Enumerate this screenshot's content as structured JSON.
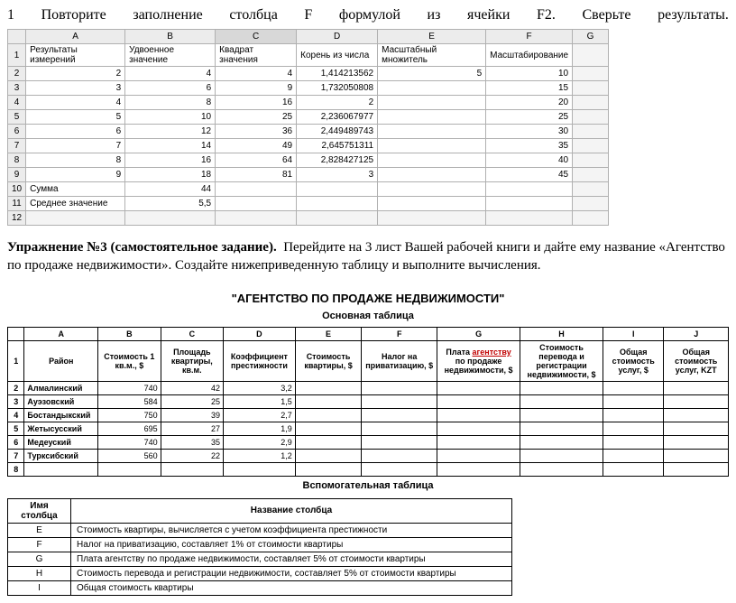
{
  "top_instruction": [
    "1",
    "Повторите",
    "заполнение",
    "столбца",
    "F",
    "формулой",
    "из",
    "ячейки",
    "F2.",
    "Сверьте",
    "результаты."
  ],
  "ss": {
    "cols": [
      "",
      "A",
      "B",
      "C",
      "D",
      "E",
      "F",
      "G"
    ],
    "header_row": [
      "1",
      "Результаты измерений",
      "Удвоенное значение",
      "Квадрат значения",
      "Корень из числа",
      "Масштабный множитель",
      "Масштабирование",
      ""
    ],
    "rows": [
      [
        "2",
        "2",
        "4",
        "4",
        "1,414213562",
        "5",
        "10",
        ""
      ],
      [
        "3",
        "3",
        "6",
        "9",
        "1,732050808",
        "",
        "15",
        ""
      ],
      [
        "4",
        "4",
        "8",
        "16",
        "2",
        "",
        "20",
        ""
      ],
      [
        "5",
        "5",
        "10",
        "25",
        "2,236067977",
        "",
        "25",
        ""
      ],
      [
        "6",
        "6",
        "12",
        "36",
        "2,449489743",
        "",
        "30",
        ""
      ],
      [
        "7",
        "7",
        "14",
        "49",
        "2,645751311",
        "",
        "35",
        ""
      ],
      [
        "8",
        "8",
        "16",
        "64",
        "2,828427125",
        "",
        "40",
        ""
      ],
      [
        "9",
        "9",
        "18",
        "81",
        "3",
        "",
        "45",
        ""
      ],
      [
        "10",
        "Сумма",
        "44",
        "",
        "",
        "",
        "",
        ""
      ],
      [
        "11",
        "Среднее значение",
        "5,5",
        "",
        "",
        "",
        "",
        ""
      ],
      [
        "12",
        "",
        "",
        "",
        "",
        "",
        "",
        ""
      ]
    ]
  },
  "ex3": {
    "title": "Упражнение №3 (самостоятельное задание).",
    "text": "Перейдите на 3 лист Вашей рабочей книги и дайте ему название «Агентство по продаже недвижимости». Создайте нижеприведенную таблицу и выполните вычисления."
  },
  "agency": {
    "title": "\"АГЕНТСТВО ПО ПРОДАЖЕ НЕДВИЖИМОСТИ\"",
    "subtitle": "Основная таблица",
    "col_letters": [
      "",
      "A",
      "B",
      "C",
      "D",
      "E",
      "F",
      "G",
      "H",
      "I",
      "J"
    ],
    "col_names": [
      "1",
      "Район",
      "Стоимость 1 кв.м., $",
      "Площадь квартиры, кв.м.",
      "Коэффициент престижности",
      "Стоимость квартиры, $",
      "Налог на приватизацию, $",
      "Плата агентству по продаже недвижимости, $",
      "Стоимость перевода и регистрации недвижимости, $",
      "Общая стоимость услуг, $",
      "Общая стоимость услуг, KZT"
    ],
    "agency_red": "агентству",
    "rows": [
      [
        "2",
        "Алмалинский",
        "740",
        "42",
        "3,2",
        "",
        "",
        "",
        "",
        "",
        ""
      ],
      [
        "3",
        "Ауэзовский",
        "584",
        "25",
        "1,5",
        "",
        "",
        "",
        "",
        "",
        ""
      ],
      [
        "4",
        "Бостандыкский",
        "750",
        "39",
        "2,7",
        "",
        "",
        "",
        "",
        "",
        ""
      ],
      [
        "5",
        "Жетысусский",
        "695",
        "27",
        "1,9",
        "",
        "",
        "",
        "",
        "",
        ""
      ],
      [
        "6",
        "Медеуский",
        "740",
        "35",
        "2,9",
        "",
        "",
        "",
        "",
        "",
        ""
      ],
      [
        "7",
        "Турксибский",
        "560",
        "22",
        "1,2",
        "",
        "",
        "",
        "",
        "",
        ""
      ],
      [
        "8",
        "",
        "",
        "",
        "",
        "",
        "",
        "",
        "",
        "",
        ""
      ]
    ]
  },
  "aux": {
    "subtitle": "Вспомогательная таблица",
    "headers": [
      "Имя столбца",
      "Название столбца"
    ],
    "rows": [
      [
        "E",
        "Стоимость квартиры, вычисляется с учетом коэффициента престижности"
      ],
      [
        "F",
        "Налог на приватизацию, составляет 1% от стоимости квартиры"
      ],
      [
        "G",
        "Плата агентству по продаже недвижимости, составляет 5% от стоимости квартиры"
      ],
      [
        "H",
        "Стоимость перевода и регистрации недвижимости, составляет 5% от стоимости квартиры"
      ],
      [
        "I",
        "Общая стоимость квартиры"
      ]
    ]
  }
}
